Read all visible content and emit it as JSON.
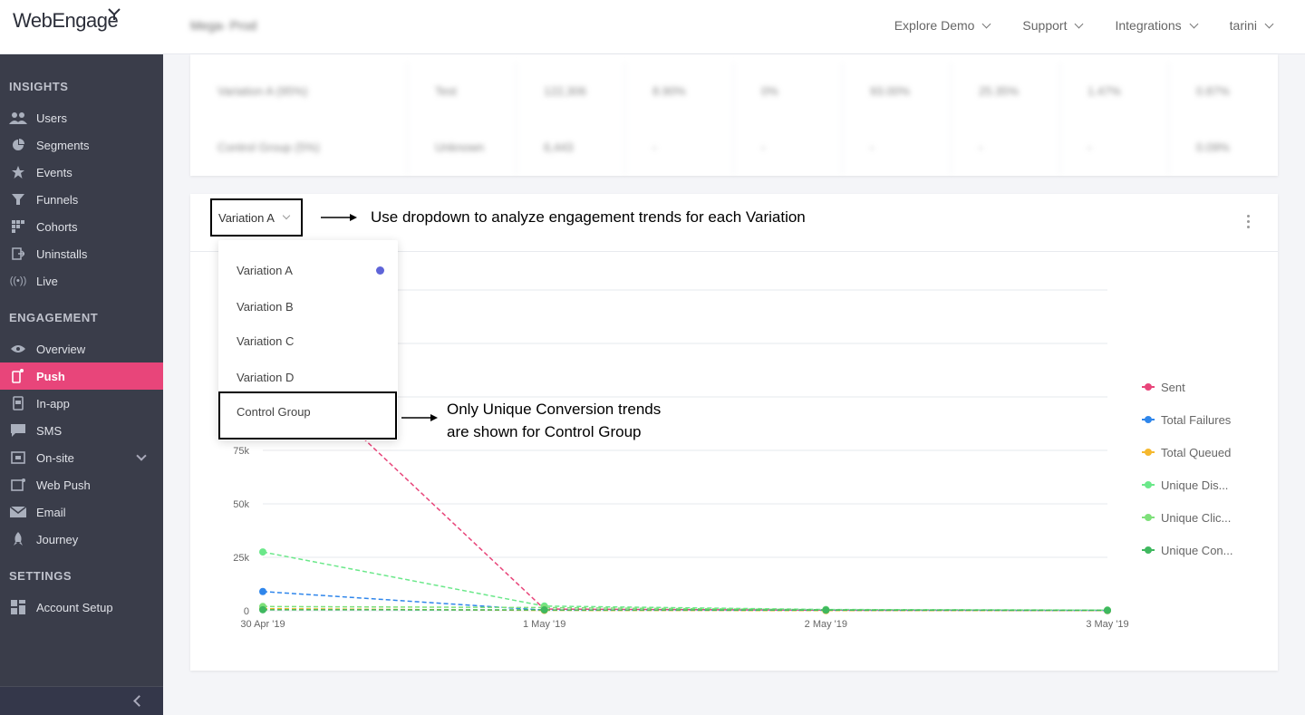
{
  "header": {
    "logo_text": "WebEngage",
    "project": "Mega- Prod",
    "nav": [
      {
        "label": "Explore Demo"
      },
      {
        "label": "Support"
      },
      {
        "label": "Integrations"
      },
      {
        "label": "tarini"
      }
    ]
  },
  "sidebar": {
    "insights_title": "INSIGHTS",
    "insights": [
      {
        "label": "Users",
        "icon": "users-icon"
      },
      {
        "label": "Segments",
        "icon": "pie-icon"
      },
      {
        "label": "Events",
        "icon": "star-icon"
      },
      {
        "label": "Funnels",
        "icon": "funnel-icon"
      },
      {
        "label": "Cohorts",
        "icon": "grid-icon"
      },
      {
        "label": "Uninstalls",
        "icon": "exit-icon"
      },
      {
        "label": "Live",
        "icon": "broadcast-icon"
      }
    ],
    "engagement_title": "ENGAGEMENT",
    "engagement": [
      {
        "label": "Overview",
        "icon": "eye-icon"
      },
      {
        "label": "Push",
        "icon": "mobile-icon",
        "active": true
      },
      {
        "label": "In-app",
        "icon": "inapp-icon"
      },
      {
        "label": "SMS",
        "icon": "chat-icon"
      },
      {
        "label": "On-site",
        "icon": "window-icon"
      },
      {
        "label": "Web Push",
        "icon": "browser-icon"
      },
      {
        "label": "Email",
        "icon": "envelope-icon"
      },
      {
        "label": "Journey",
        "icon": "rocket-icon"
      }
    ],
    "settings_title": "SETTINGS",
    "settings": [
      {
        "label": "Account Setup",
        "icon": "apps-icon"
      }
    ]
  },
  "stats": {
    "rows": [
      [
        "Variation A (95%)",
        "Test",
        "122,306",
        "8.90%",
        "0%",
        "93.00%",
        "25.35%",
        "1.47%",
        "0.87%"
      ],
      [
        "Control Group (5%)",
        "Unknown",
        "6,443",
        "-",
        "-",
        "-",
        "-",
        "-",
        "0.09%"
      ]
    ]
  },
  "chart_card": {
    "selected_variation": "Variation A",
    "annotation_dropdown": "Use dropdown to analyze engagement trends for each Variation",
    "annotation_control_line1": "Only Unique Conversion trends",
    "annotation_control_line2": "are shown for Control Group",
    "dropdown_options": [
      "Variation A",
      "Variation B",
      "Variation C",
      "Variation D",
      "Control Group"
    ]
  },
  "chart_data": {
    "type": "line",
    "x": [
      "30 Apr '19",
      "1 May '19",
      "2 May '19",
      "3 May '19"
    ],
    "yticks": [
      0,
      25000,
      50000,
      75000
    ],
    "ytick_labels": [
      "0",
      "25k",
      "50k",
      "75k"
    ],
    "ylim": [
      0,
      125000
    ],
    "legend_position": "right",
    "series": [
      {
        "name": "Sent",
        "color": "#e8457a",
        "values": [
          125000,
          800,
          300,
          200
        ]
      },
      {
        "name": "Total Failures",
        "color": "#2f86eb",
        "values": [
          9000,
          300,
          200,
          100
        ]
      },
      {
        "name": "Total Queued",
        "color": "#f5b82e",
        "values": [
          1000,
          200,
          100,
          100
        ]
      },
      {
        "name": "Unique Dis...",
        "color": "#6be88a",
        "values": [
          27500,
          2200,
          600,
          300
        ]
      },
      {
        "name": "Unique Clic...",
        "color": "#7ee07a",
        "values": [
          2000,
          1500,
          500,
          300
        ]
      },
      {
        "name": "Unique Con...",
        "color": "#3fb85f",
        "values": [
          500,
          400,
          300,
          200
        ]
      }
    ]
  }
}
